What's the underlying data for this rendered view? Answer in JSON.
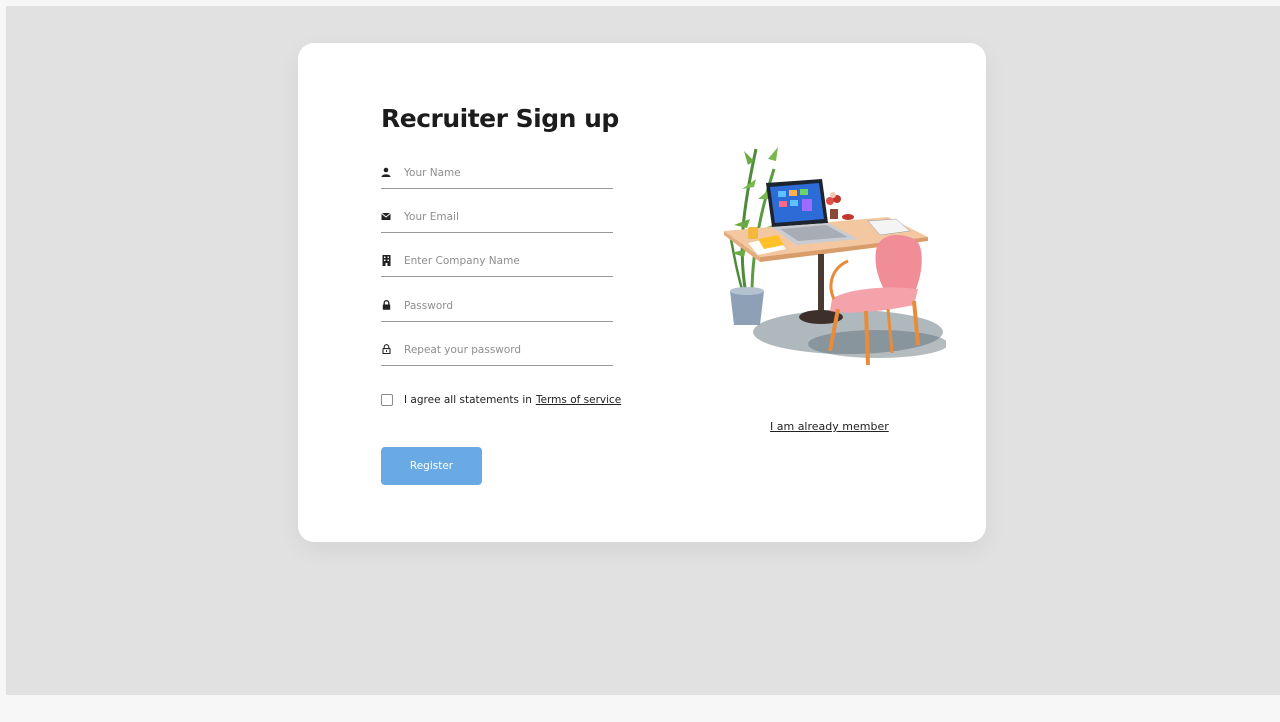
{
  "page": {
    "title": "Recruiter Sign up"
  },
  "form": {
    "name_placeholder": "Your Name",
    "email_placeholder": "Your Email",
    "company_placeholder": "Enter Company Name",
    "password_placeholder": "Password",
    "repeat_placeholder": "Repeat your password",
    "agree_text": "I agree all statements in",
    "terms_link": "Terms of service",
    "register_label": "Register"
  },
  "links": {
    "member_label": "I am already member"
  },
  "icons": {
    "name": "user-icon",
    "email": "envelope-icon",
    "company": "building-icon",
    "password": "lock-icon",
    "repeat": "lock-open-icon"
  },
  "colors": {
    "background": "#e1e1e1",
    "card": "#ffffff",
    "button": "#6aaae4",
    "title": "#1c1c1c"
  }
}
